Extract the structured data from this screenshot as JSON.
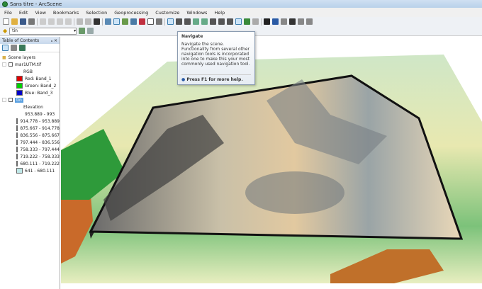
{
  "window": {
    "title": "Sans titre - ArcScene"
  },
  "menu": [
    "File",
    "Edit",
    "View",
    "Bookmarks",
    "Selection",
    "Geoprocessing",
    "Customize",
    "Windows",
    "Help"
  ],
  "layer_dropdown": {
    "value": "tin"
  },
  "toc": {
    "title": "Table of Contents",
    "controls": "ₐ ×",
    "root": "Scene layers",
    "raster": {
      "name": "mar1UTM.tif",
      "rgb_label": "RGB",
      "bands": [
        {
          "label": "Red:  Band_1",
          "color": "#e00000"
        },
        {
          "label": "Green: Band_2",
          "color": "#00d000"
        },
        {
          "label": "Blue:  Band_3",
          "color": "#0000c8"
        }
      ]
    },
    "tin": {
      "name": "tin",
      "legend_title": "Elevation",
      "classes": [
        {
          "label": "953.889 - 993",
          "color": "#ffffff"
        },
        {
          "label": "914.778 - 953.889",
          "color": "#bdbdbd"
        },
        {
          "label": "875.667 - 914.778",
          "color": "#7a5a45"
        },
        {
          "label": "836.556 - 875.667",
          "color": "#5a2008"
        },
        {
          "label": "797.444 - 836.556",
          "color": "#b4581c"
        },
        {
          "label": "758.333 - 797.444",
          "color": "#a8a040"
        },
        {
          "label": "719.222 - 758.333",
          "color": "#2a9a30"
        },
        {
          "label": "680.111 - 719.222",
          "color": "#f5f5c8"
        },
        {
          "label": "641 - 680.111",
          "color": "#bfe8e8"
        }
      ]
    }
  },
  "tooltip": {
    "title": "Navigate",
    "body": "Navigate the scene. Functionality from several other navigation tools is incorporated into one to make this your most commonly used navigation tool.",
    "help": "Press F1 for more help."
  }
}
